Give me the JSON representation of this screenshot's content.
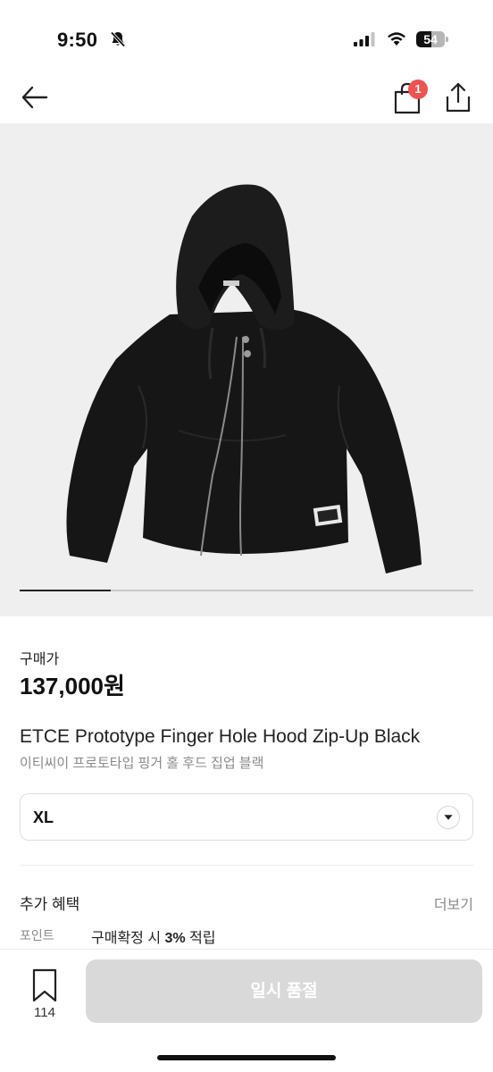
{
  "status_bar": {
    "time": "9:50",
    "battery": "54",
    "battery_level": 0.54,
    "icons": [
      "bell-slash-icon",
      "signal-icon",
      "wifi-icon",
      "battery-icon"
    ]
  },
  "nav": {
    "back_icon": "arrow-left-icon",
    "cart_icon": "shopping-bag-icon",
    "cart_badge": "1",
    "share_icon": "share-icon"
  },
  "gallery": {
    "image_index_progress": 0.2
  },
  "product": {
    "price_label": "구매가",
    "price": "137,000원",
    "title_en": "ETCE Prototype Finger Hole Hood Zip-Up Black",
    "title_ko": "이티씨이 프로토타입 핑거 홀 후드 집업 블랙"
  },
  "size_select": {
    "value": "XL",
    "icon": "chevron-down-icon"
  },
  "benefits": {
    "title": "추가 혜택",
    "more_label": "더보기",
    "point_label": "포인트",
    "point_prefix": "구매확정 시 ",
    "point_rate": "3%",
    "point_suffix": " 적립"
  },
  "bottom_bar": {
    "bookmark_icon": "bookmark-icon",
    "bookmark_count": "114",
    "buy_label": "일시 품절"
  },
  "colors": {
    "badge": "#ef5350",
    "button_disabled": "#d9d9d9",
    "gallery_bg": "#efefef"
  }
}
